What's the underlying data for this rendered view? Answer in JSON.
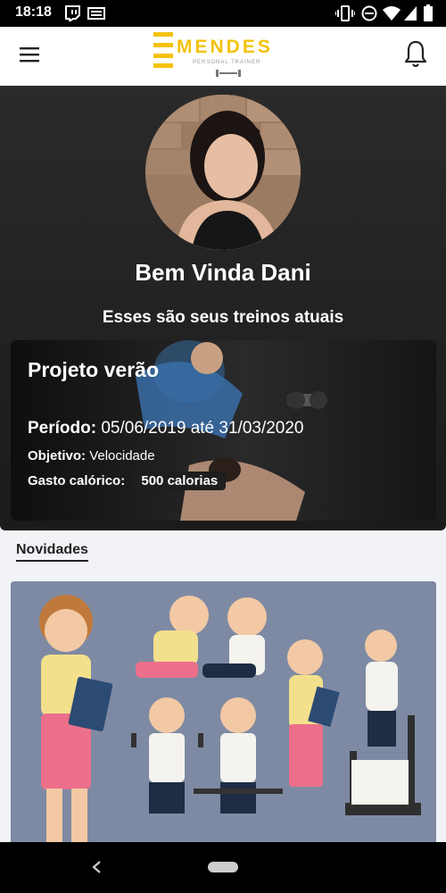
{
  "status": {
    "time": "18:18"
  },
  "logo": {
    "name": "MENDES",
    "tagline": "PERSONAL TRAINER"
  },
  "hero": {
    "welcome": "Bem Vinda Dani",
    "subtitle": "Esses são seus treinos atuais"
  },
  "workout": {
    "title": "Projeto verão",
    "period_label": "Período:",
    "period_value": "05/06/2019 até 31/03/2020",
    "objective_label": "Objetivo:",
    "objective_value": "Velocidade",
    "calorie_label": "Gasto calórico:",
    "calorie_value": "500 calorias"
  },
  "news": {
    "label": "Novidades"
  },
  "colors": {
    "accent": "#f4c20d",
    "hero_bg": "#222222",
    "news_bg": "#7e8aa3"
  }
}
